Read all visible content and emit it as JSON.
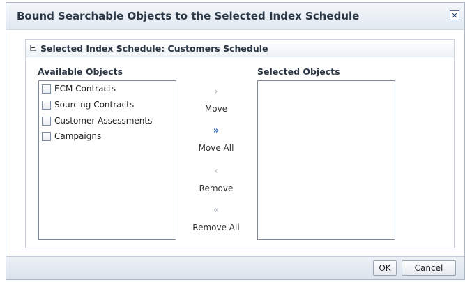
{
  "dialog": {
    "title": "Bound Searchable Objects to the Selected Index Schedule",
    "close_icon": "close-icon"
  },
  "panel": {
    "title": "Selected Index Schedule: Customers Schedule",
    "disclosure_icon": "collapse-icon"
  },
  "available": {
    "label": "Available Objects",
    "items": [
      {
        "label": "ECM Contracts",
        "checked": false
      },
      {
        "label": "Sourcing Contracts",
        "checked": false
      },
      {
        "label": "Customer Assessments",
        "checked": false
      },
      {
        "label": "Campaigns",
        "checked": false
      }
    ]
  },
  "selected": {
    "label": "Selected Objects",
    "items": []
  },
  "shuttle": {
    "move": {
      "label": "Move",
      "icon": "chevron-right-icon"
    },
    "move_all": {
      "label": "Move All",
      "icon": "double-chevron-right-icon"
    },
    "remove": {
      "label": "Remove",
      "icon": "chevron-left-icon"
    },
    "remove_all": {
      "label": "Remove All",
      "icon": "double-chevron-left-icon"
    }
  },
  "footer": {
    "ok_label": "OK",
    "cancel_label": "Cancel"
  }
}
